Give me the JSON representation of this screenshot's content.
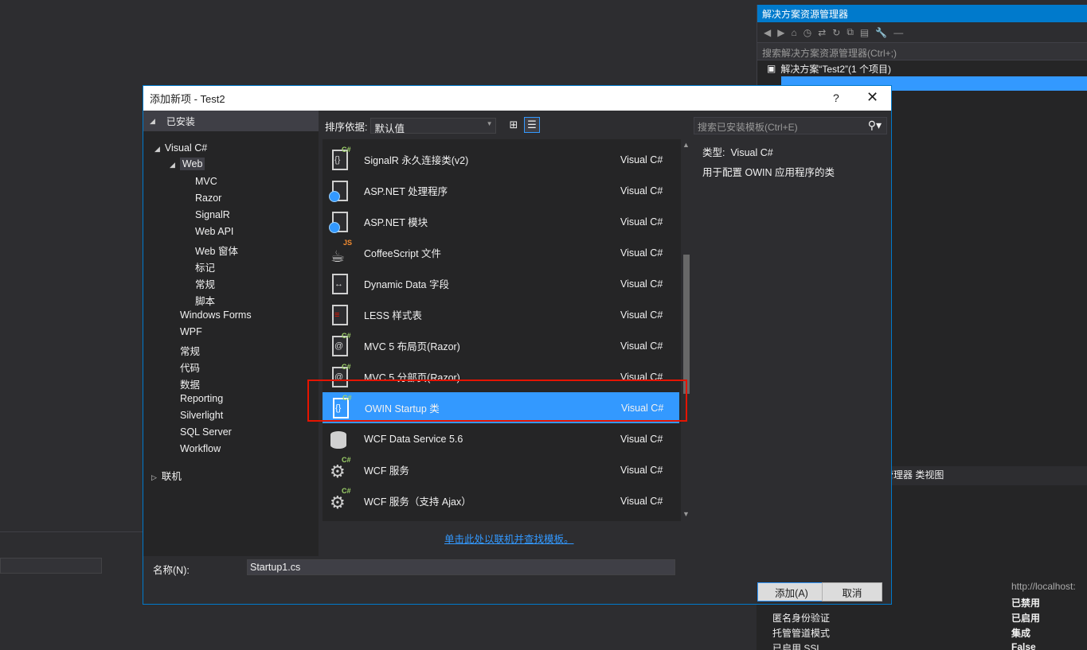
{
  "background": {
    "solution_explorer": {
      "title": "解决方案资源管理器",
      "search_placeholder": "搜索解决方案资源管理器(Ctrl+;)",
      "solution_item": "解决方案“Test2”(1 个项目)",
      "tabs": "管理器  类视图"
    },
    "properties": {
      "url_value": "http://localhost:",
      "rows": [
        {
          "key": "",
          "value": "已禁用"
        },
        {
          "key": "匿名身份验证",
          "value": "已启用"
        },
        {
          "key": "托管管道模式",
          "value": "集成"
        },
        {
          "key": "已启用 SSL",
          "value": "False"
        }
      ]
    }
  },
  "dialog": {
    "title": "添加新项 - Test2",
    "help": "?",
    "close": "✕",
    "installed_header": "已安装",
    "tree": {
      "visual_csharp": "Visual C#",
      "web": "Web",
      "web_children": [
        "MVC",
        "Razor",
        "SignalR",
        "Web API",
        "Web 窗体",
        "标记",
        "常规",
        "脚本"
      ],
      "other": [
        "Windows Forms",
        "WPF",
        "常规",
        "代码",
        "数据",
        "Reporting",
        "Silverlight",
        "SQL Server",
        "Workflow"
      ],
      "online": "联机"
    },
    "sort_label": "排序依据:",
    "sort_value": "默认值",
    "search_placeholder": "搜索已安装模板(Ctrl+E)",
    "items": [
      {
        "name": "SignalR 永久连接类(v2)",
        "lang": "Visual C#",
        "icon": "cs-class-icon"
      },
      {
        "name": "ASP.NET 处理程序",
        "lang": "Visual C#",
        "icon": "aspnet-handler-icon"
      },
      {
        "name": "ASP.NET 模块",
        "lang": "Visual C#",
        "icon": "aspnet-module-icon"
      },
      {
        "name": "CoffeeScript 文件",
        "lang": "Visual C#",
        "icon": "coffeescript-icon"
      },
      {
        "name": "Dynamic Data 字段",
        "lang": "Visual C#",
        "icon": "dynamic-data-icon"
      },
      {
        "name": "LESS 样式表",
        "lang": "Visual C#",
        "icon": "less-icon"
      },
      {
        "name": "MVC 5 布局页(Razor)",
        "lang": "Visual C#",
        "icon": "razor-layout-icon"
      },
      {
        "name": "MVC 5 分部页(Razor)",
        "lang": "Visual C#",
        "icon": "razor-partial-icon"
      },
      {
        "name": "OWIN Startup 类",
        "lang": "Visual C#",
        "icon": "cs-class-icon"
      },
      {
        "name": "WCF Data Service 5.6",
        "lang": "Visual C#",
        "icon": "data-service-icon"
      },
      {
        "name": "WCF 服务",
        "lang": "Visual C#",
        "icon": "wcf-service-icon"
      },
      {
        "name": "WCF 服务（支持 Ajax）",
        "lang": "Visual C#",
        "icon": "wcf-ajax-icon"
      }
    ],
    "selected_index": 8,
    "online_link": "单击此处以联机并查找模板。",
    "detail": {
      "type_label": "类型:",
      "type_value": "Visual C#",
      "description": "用于配置 OWIN 应用程序的类"
    },
    "name_label": "名称(N):",
    "name_value": "Startup1.cs",
    "add_button": "添加(A)",
    "cancel_button": "取消"
  }
}
